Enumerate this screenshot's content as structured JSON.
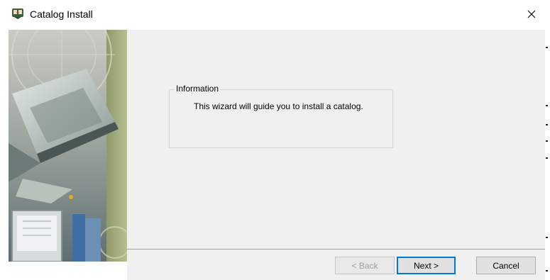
{
  "window": {
    "title": "Catalog Install",
    "icon": "catalog-app-icon",
    "close_icon": "close-icon"
  },
  "info_group": {
    "legend": "Information",
    "text": "This wizard will guide you to install a catalog."
  },
  "buttons": {
    "back": "< Back",
    "next": "Next >",
    "cancel": "Cancel"
  },
  "colors": {
    "content_bg": "#f0f0f0",
    "default_button_border": "#0078d7"
  }
}
